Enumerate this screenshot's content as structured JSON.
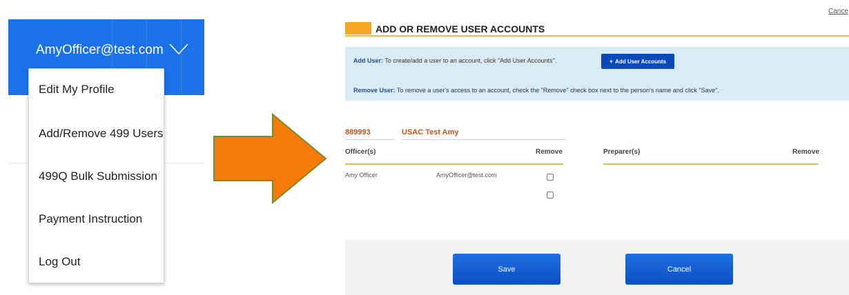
{
  "user_menu": {
    "email": "AmyOfficer@test.com",
    "items": [
      {
        "label": "Edit My Profile"
      },
      {
        "label": "Add/Remove 499 Users"
      },
      {
        "label": "499Q Bulk Submission"
      },
      {
        "label": "Payment Instruction"
      },
      {
        "label": "Log Out"
      }
    ]
  },
  "colors": {
    "header_blue": "#1b72e8",
    "arrow_orange": "#f57b0a",
    "arrow_outline": "#6f8e2c",
    "accent_orange": "#f5a623",
    "info_bg": "#d9ecf6",
    "button_blue": "#0b4fc2",
    "account_text": "#c0541a"
  },
  "form": {
    "cancel_link": "Cance",
    "title": "ADD OR REMOVE USER ACCOUNTS",
    "add_user": {
      "label": "Add User:",
      "text": "To create/add a user to an account, click \"Add User Accounts\".",
      "button": "Add User Accounts",
      "button_icon": "plus-icon"
    },
    "remove_user": {
      "label": "Remove User:",
      "text": "To remove a user's access to an account, check the \"Remove\" check box next to the person's name and click \"Save\"."
    },
    "account": {
      "id": "889993",
      "name": "USAC Test Amy"
    },
    "officers": {
      "header": "Officer(s)",
      "remove_header": "Remove",
      "rows": [
        {
          "name": "Amy Officer",
          "email": "AmyOfficer@test.com",
          "remove": false
        },
        {
          "name": "",
          "email": "",
          "remove": false
        }
      ]
    },
    "preparers": {
      "header": "Preparer(s)",
      "remove_header": "Remove"
    },
    "save_button": "Save",
    "cancel_button": "Cancel"
  }
}
